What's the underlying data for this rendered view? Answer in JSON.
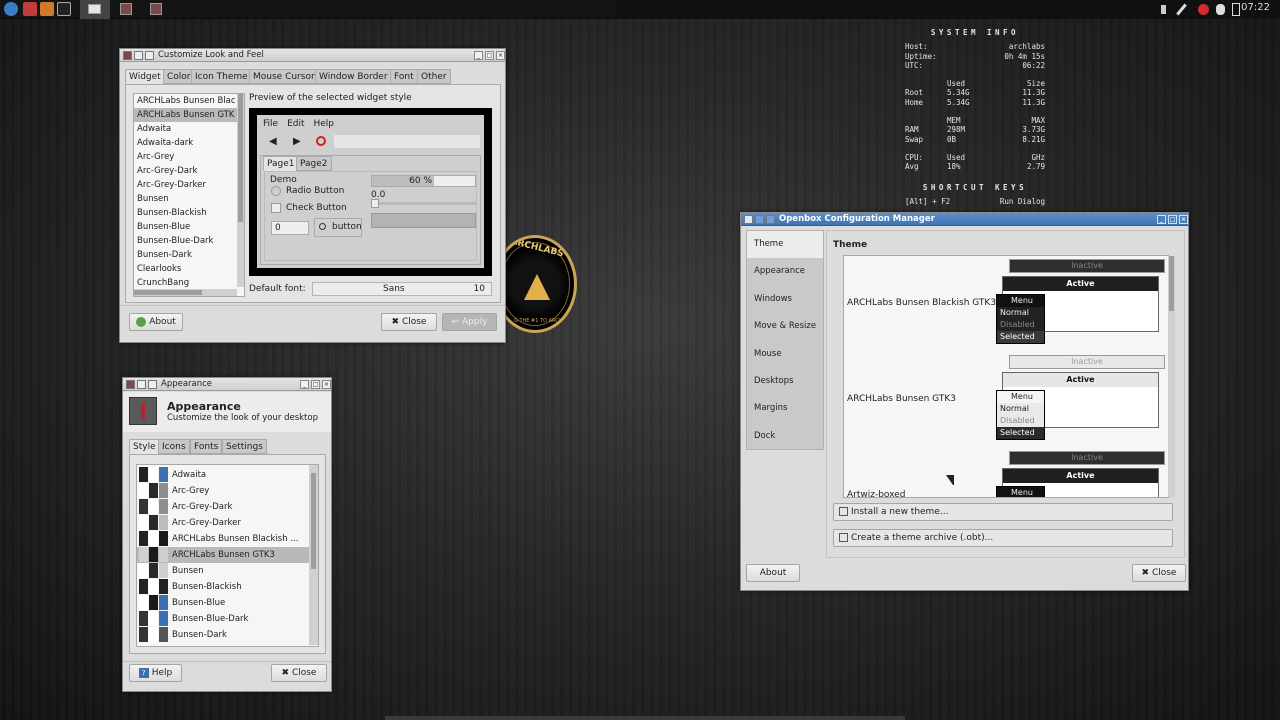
{
  "panel": {
    "clock": "07:22",
    "icons": [
      "app-launcher-icon",
      "terminal-red-icon",
      "package-icon",
      "terminal-icon"
    ],
    "tray": [
      "volume-icon",
      "pen-icon",
      "red-settings-icon",
      "bug-icon",
      "battery-icon"
    ]
  },
  "conky": {
    "header": "SYSTEM INFO",
    "host_label": "Host:",
    "host": "archlabs",
    "uptime_label": "Uptime:",
    "uptime": "0h 4m 15s",
    "utc_label": "UTC:",
    "utc": "06:22",
    "disk_head": [
      "",
      "Used",
      "Size"
    ],
    "disk": [
      [
        "Root",
        "5.34G",
        "11.3G"
      ],
      [
        "Home",
        "5.34G",
        "11.3G"
      ]
    ],
    "mem_head": [
      "",
      "MEM",
      "MAX"
    ],
    "mem": [
      [
        "RAM",
        "298M",
        "3.73G"
      ],
      [
        "Swap",
        "0B",
        "8.21G"
      ]
    ],
    "cpu_head": [
      "CPU:",
      "Used",
      "GHz"
    ],
    "cpu": [
      [
        "Avg",
        "18%",
        "2.79"
      ]
    ],
    "shortcuts_header": "SHORTCUT KEYS",
    "shortcut_row": [
      "[Alt] + F2",
      "Run Dialog"
    ]
  },
  "logo": {
    "text": "ARCHLABS",
    "tagline": "G THE #1 TO ARCH"
  },
  "lxappearance": {
    "title": "Customize Look and Feel",
    "tabs": [
      "Widget",
      "Color",
      "Icon Theme",
      "Mouse Cursor",
      "Window Border",
      "Font",
      "Other"
    ],
    "themes": [
      "ARCHLabs Bunsen Blac",
      "ARCHLabs Bunsen GTK",
      "Adwaita",
      "Adwaita-dark",
      "Arc-Grey",
      "Arc-Grey-Dark",
      "Arc-Grey-Darker",
      "Bunsen",
      "Bunsen-Blackish",
      "Bunsen-Blue",
      "Bunsen-Blue-Dark",
      "Bunsen-Dark",
      "Clearlooks",
      "CrunchBang"
    ],
    "selected_index": 1,
    "preview_label": "Preview of the selected widget style",
    "preview": {
      "menu": [
        "File",
        "Edit",
        "Help"
      ],
      "tabs": [
        "Page1",
        "Page2"
      ],
      "demo_label": "Demo",
      "radio": "Radio Button",
      "check": "Check Button",
      "progress_text": "60 %",
      "progress": 0.6,
      "scale_value": "0.0",
      "spin_value": "0",
      "button": "button"
    },
    "font_label": "Default font:",
    "font_name": "Sans",
    "font_size": "10",
    "about": "About",
    "close": "Close",
    "apply": "Apply"
  },
  "xfce": {
    "title": "Appearance",
    "heading": "Appearance",
    "subheading": "Customize the look of your desktop",
    "tabs": [
      "Style",
      "Icons",
      "Fonts",
      "Settings"
    ],
    "styles": [
      {
        "name": "Adwaita",
        "colors": [
          "#222222",
          "#ffffff",
          "#3e6fb1"
        ]
      },
      {
        "name": "Arc-Grey",
        "colors": [
          "#ffffff",
          "#2a2a2a",
          "#8e8e8e"
        ]
      },
      {
        "name": "Arc-Grey-Dark",
        "colors": [
          "#333333",
          "#ffffff",
          "#8e8e8e"
        ]
      },
      {
        "name": "Arc-Grey-Darker",
        "colors": [
          "#ffffff",
          "#2a2a2a",
          "#bdbdbd"
        ]
      },
      {
        "name": "ARCHLabs Bunsen Blackish ...",
        "colors": [
          "#222222",
          "#ffffff",
          "#1a1a1a"
        ]
      },
      {
        "name": "ARCHLabs Bunsen GTK3",
        "colors": [
          "#cfcfcf",
          "#1a1a1a",
          "#cfcfcf"
        ]
      },
      {
        "name": "Bunsen",
        "colors": [
          "#ffffff",
          "#2a2a2a",
          "#cfcfcf"
        ]
      },
      {
        "name": "Bunsen-Blackish",
        "colors": [
          "#222222",
          "#ffffff",
          "#222222"
        ]
      },
      {
        "name": "Bunsen-Blue",
        "colors": [
          "#ffffff",
          "#1a1a1a",
          "#3e6fb1"
        ]
      },
      {
        "name": "Bunsen-Blue-Dark",
        "colors": [
          "#333333",
          "#ffffff",
          "#3e6fb1"
        ]
      },
      {
        "name": "Bunsen-Dark",
        "colors": [
          "#333333",
          "#ffffff",
          "#555555"
        ]
      }
    ],
    "selected_index": 5,
    "help": "Help",
    "close": "Close"
  },
  "obconf": {
    "title": "Openbox Configuration Manager",
    "sidebar": [
      "Theme",
      "Appearance",
      "Windows",
      "Move & Resize",
      "Mouse",
      "Desktops",
      "Margins",
      "Dock"
    ],
    "section": "Theme",
    "themes": [
      {
        "name": "ARCHLabs Bunsen Blackish GTK3",
        "style": "dark"
      },
      {
        "name": "ARCHLabs Bunsen GTK3",
        "style": "light"
      },
      {
        "name": "Artwiz-boxed",
        "style": "dark"
      }
    ],
    "preview": {
      "inactive": "Inactive",
      "active": "Active",
      "menu": "Menu",
      "normal": "Normal",
      "disabled": "Disabled",
      "selected": "Selected"
    },
    "install": "Install a new theme...",
    "archive": "Create a theme archive (.obt)...",
    "about": "About",
    "close": "Close"
  }
}
